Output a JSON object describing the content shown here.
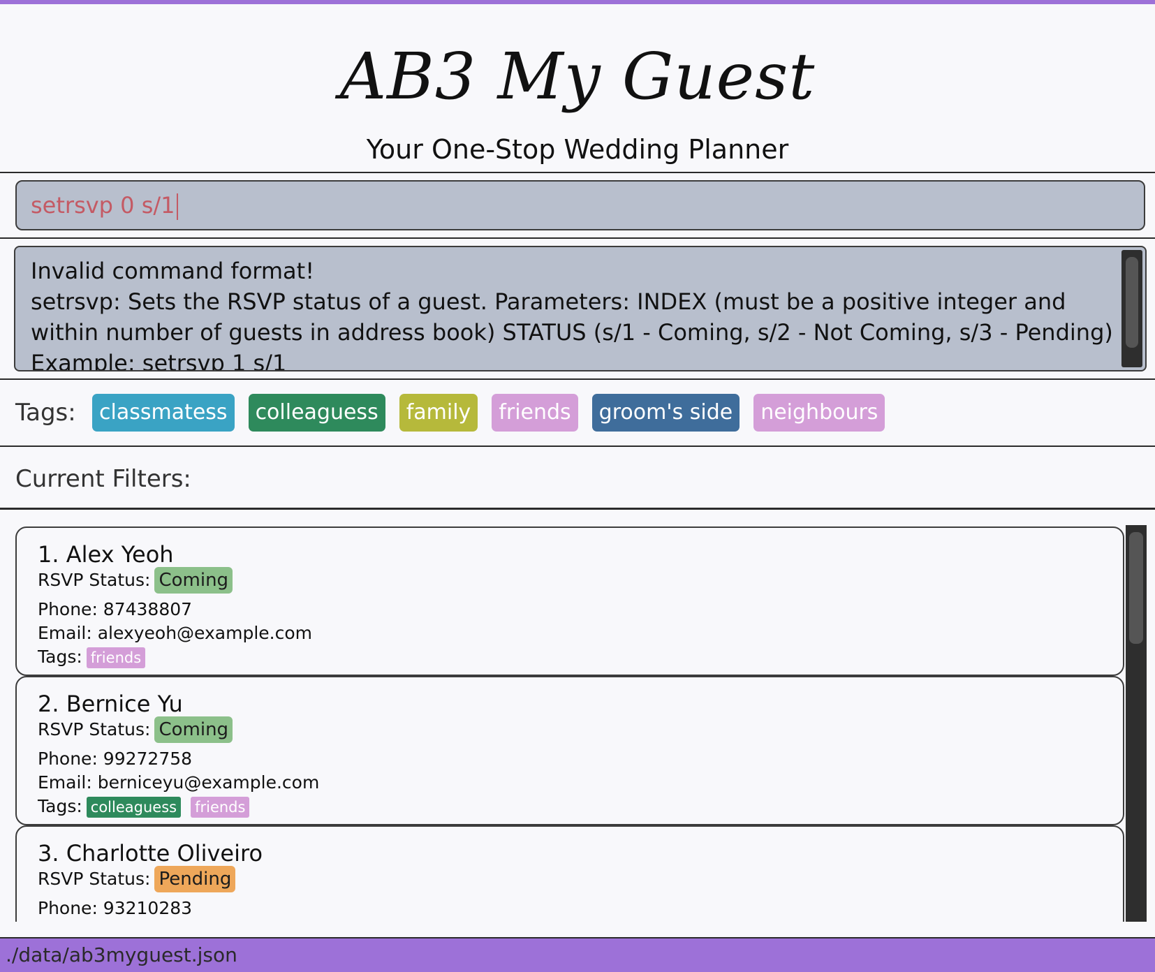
{
  "header": {
    "app_title": "AB3 My Guest",
    "subtitle": "Your One-Stop Wedding Planner"
  },
  "command": {
    "value": "setrsvp 0 s/1",
    "text_color": "#c45a64"
  },
  "result": {
    "lines": [
      "Invalid command format!",
      "setrsvp: Sets the RSVP status of a guest. Parameters: INDEX (must be a positive integer and within number of guests in address book) STATUS (s/1 - Coming, s/2 - Not Coming, s/3 - Pending)",
      "Example: setrsvp 1 s/1"
    ]
  },
  "tags_panel": {
    "label": "Tags:",
    "tags": [
      {
        "name": "classmatess",
        "color": "#3aa3c4"
      },
      {
        "name": "colleaguess",
        "color": "#2e8a5c"
      },
      {
        "name": "family",
        "color": "#b6b93b"
      },
      {
        "name": "friends",
        "color": "#d49ed8"
      },
      {
        "name": "groom's side",
        "color": "#3f6d9b"
      },
      {
        "name": "neighbours",
        "color": "#d49ed8"
      }
    ]
  },
  "filters": {
    "label": "Current Filters:"
  },
  "guests": [
    {
      "name": "1. Alex Yeoh",
      "rsvp_label": "RSVP Status:",
      "rsvp": "Coming",
      "rsvp_color": "#8cc08a",
      "phone": "Phone: 87438807",
      "email": "Email: alexyeoh@example.com",
      "tags_label": "Tags:",
      "tags": [
        {
          "name": "friends",
          "color": "#d49ed8"
        }
      ]
    },
    {
      "name": "2. Bernice Yu",
      "rsvp_label": "RSVP Status:",
      "rsvp": "Coming",
      "rsvp_color": "#8cc08a",
      "phone": "Phone: 99272758",
      "email": "Email: berniceyu@example.com",
      "tags_label": "Tags:",
      "tags": [
        {
          "name": "colleaguess",
          "color": "#2e8a5c"
        },
        {
          "name": "friends",
          "color": "#d49ed8"
        }
      ]
    },
    {
      "name": "3. Charlotte Oliveiro",
      "rsvp_label": "RSVP Status:",
      "rsvp": "Pending",
      "rsvp_color": "#eea75a",
      "phone": "Phone: 93210283",
      "email": "",
      "tags_label": "",
      "tags": []
    }
  ],
  "status_bar": {
    "path": "./data/ab3myguest.json"
  },
  "colors": {
    "accent": "#9d71d8",
    "panel": "#b8bfcd"
  }
}
